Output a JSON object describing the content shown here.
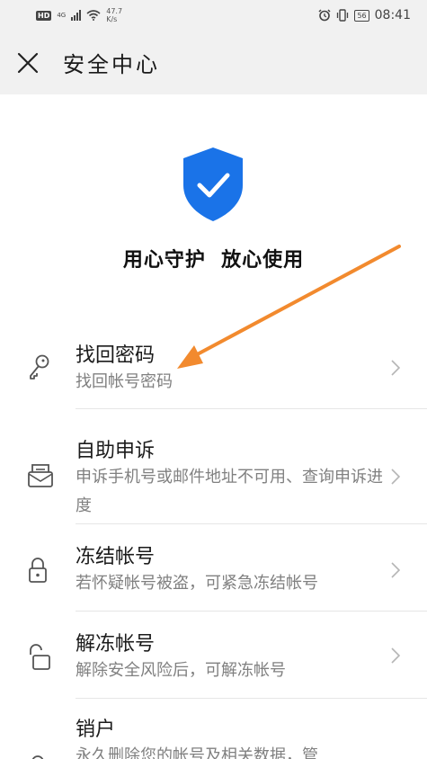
{
  "status_bar": {
    "hd": "HD",
    "network": "4G",
    "speed_value": "47.7",
    "speed_unit": "K/s",
    "battery": "56",
    "time": "08:41"
  },
  "header": {
    "close_icon": "close-icon",
    "title": "安全中心"
  },
  "hero": {
    "shield_icon": "shield-check-icon",
    "shield_color": "#1a73e8",
    "slogan": "用心守护  放心使用"
  },
  "items": [
    {
      "icon": "key-icon",
      "title": "找回密码",
      "desc": "找回帐号密码"
    },
    {
      "icon": "mail-appeal-icon",
      "title": "自助申诉",
      "desc": "申诉手机号或邮件地址不可用、查询申诉进度"
    },
    {
      "icon": "lock-icon",
      "title": "冻结帐号",
      "desc": "若怀疑帐号被盗，可紧急冻结帐号"
    },
    {
      "icon": "unlock-icon",
      "title": "解冻帐号",
      "desc": "解除安全风险后，可解冻帐号"
    },
    {
      "icon": "user-remove-icon",
      "title": "销户",
      "desc": "永久删除您的帐号及相关数据，管"
    }
  ],
  "annotation": {
    "color": "#f28a2e"
  }
}
